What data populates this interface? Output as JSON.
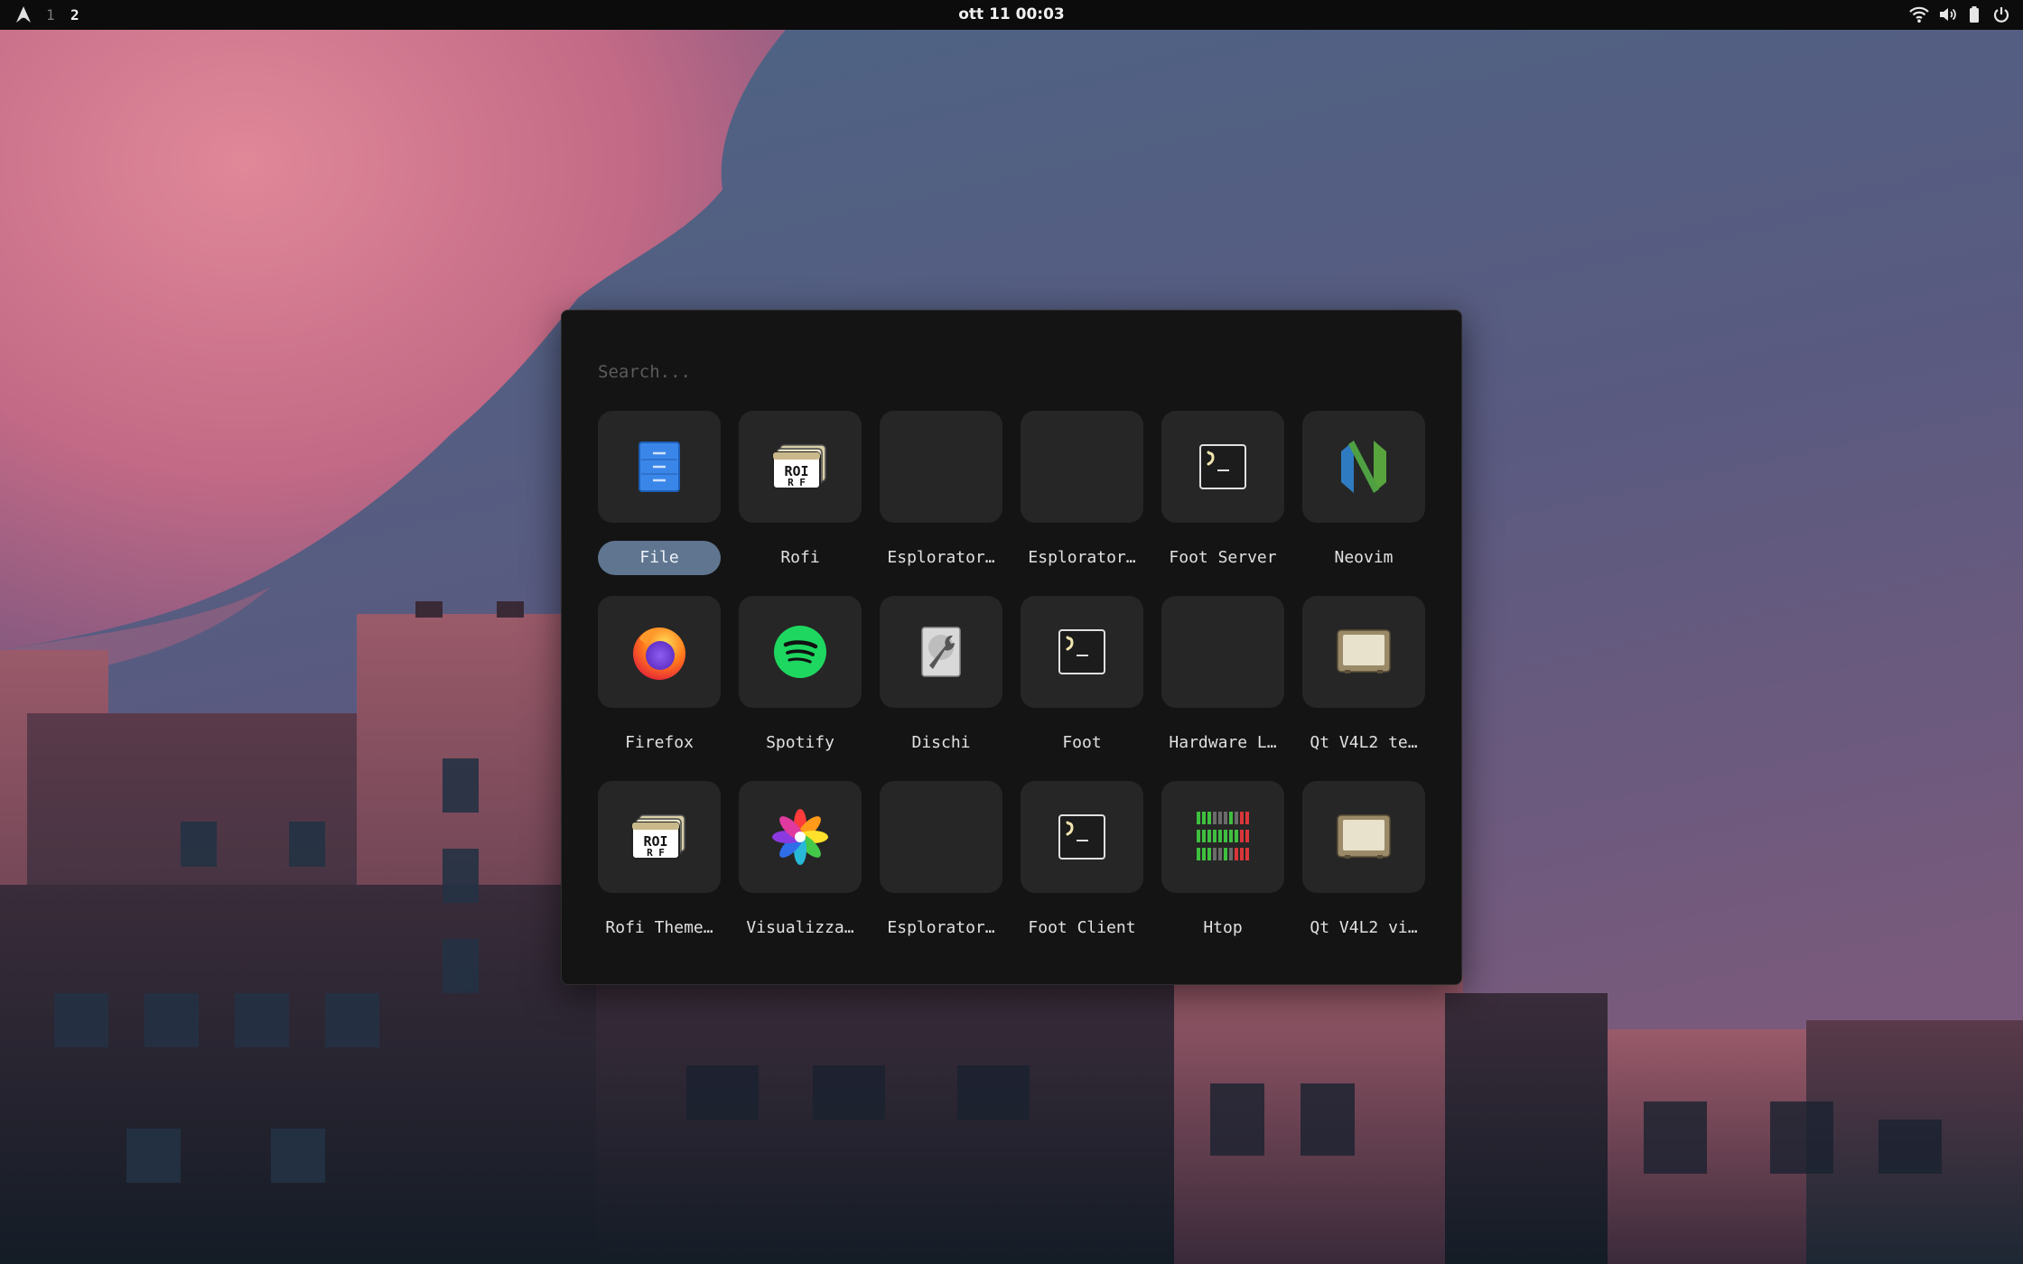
{
  "topbar": {
    "workspaces": [
      "1",
      "2"
    ],
    "active_workspace": "2",
    "clock": "ott 11 00:03",
    "tray_icons": [
      "wifi-icon",
      "volume-icon",
      "battery-icon",
      "power-icon"
    ]
  },
  "launcher": {
    "search_placeholder": "Search...",
    "search_value": "",
    "selected_index": 0,
    "apps": [
      {
        "label": "File",
        "icon": "file-manager-icon"
      },
      {
        "label": "Rofi",
        "icon": "rofi-icon"
      },
      {
        "label": "Esplorator…",
        "icon": "blank-icon"
      },
      {
        "label": "Esplorator…",
        "icon": "blank-icon"
      },
      {
        "label": "Foot Server",
        "icon": "terminal-icon"
      },
      {
        "label": "Neovim",
        "icon": "neovim-icon"
      },
      {
        "label": "Firefox",
        "icon": "firefox-icon"
      },
      {
        "label": "Spotify",
        "icon": "spotify-icon"
      },
      {
        "label": "Dischi",
        "icon": "disks-icon"
      },
      {
        "label": "Foot",
        "icon": "terminal-icon"
      },
      {
        "label": "Hardware L…",
        "icon": "blank-icon"
      },
      {
        "label": "Qt V4L2 te…",
        "icon": "webcam-icon"
      },
      {
        "label": "Rofi Theme…",
        "icon": "rofi-icon"
      },
      {
        "label": "Visualizza…",
        "icon": "image-viewer-icon"
      },
      {
        "label": "Esplorator…",
        "icon": "blank-icon"
      },
      {
        "label": "Foot Client",
        "icon": "terminal-icon"
      },
      {
        "label": "Htop",
        "icon": "htop-icon"
      },
      {
        "label": "Qt V4L2 vi…",
        "icon": "webcam-icon"
      }
    ]
  },
  "colors": {
    "topbar_bg": "#0c0c0c",
    "launcher_bg": "#141414",
    "tile_bg": "#262626",
    "selected_label_bg": "#5f7590",
    "text": "#e0e0e0"
  }
}
